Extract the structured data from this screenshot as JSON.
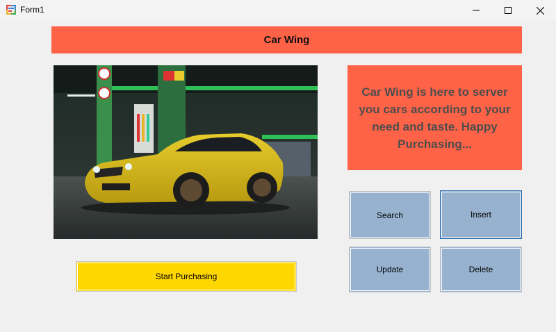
{
  "window": {
    "title": "Form1",
    "icons": {
      "app": "app-form-icon",
      "minimize": "minimize-icon",
      "maximize": "maximize-icon",
      "close": "close-icon"
    }
  },
  "header": {
    "title": "Car Wing"
  },
  "info": {
    "text": "Car Wing is here to server you cars according to your need and taste. Happy Purchasing..."
  },
  "buttons": {
    "search": "Search",
    "insert": "Insert",
    "update": "Update",
    "delete": "Delete",
    "start_purchasing": "Start Purchasing"
  },
  "colors": {
    "header_bg": "#ff6347",
    "info_bg": "#ff6347",
    "info_text": "#4d4d4d",
    "action_button_bg": "#97b2cf",
    "start_button_bg": "#ffd700",
    "form_bg": "#f0f0f0"
  },
  "image": {
    "subject": "yellow-sports-car-at-gas-station"
  }
}
